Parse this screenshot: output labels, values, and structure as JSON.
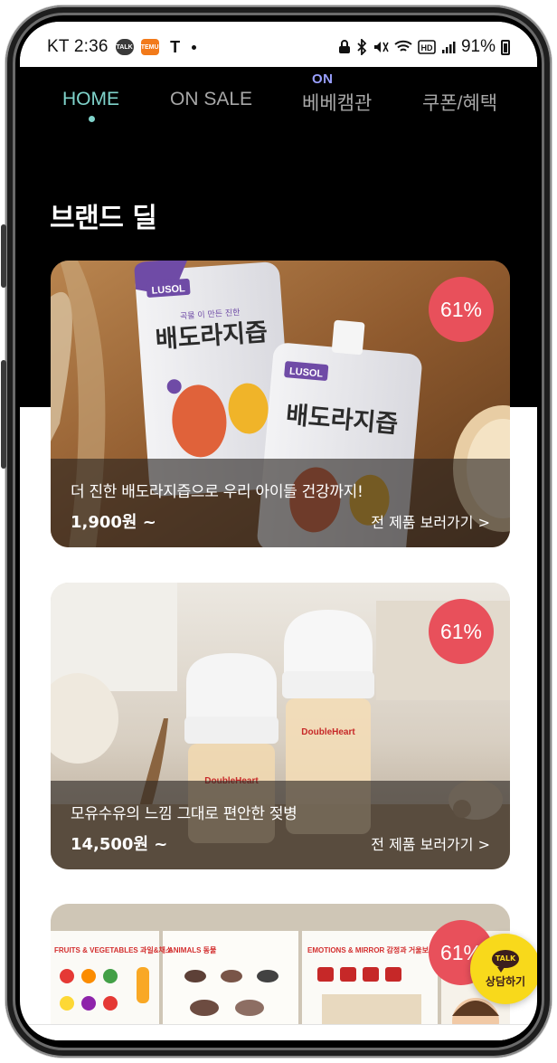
{
  "status_bar": {
    "carrier": "KT",
    "time": "2:36",
    "chip_talk": "TALK",
    "chip_temu": "TEMU",
    "chip_t": "T",
    "battery": "91%"
  },
  "tabs": [
    {
      "label": "HOME",
      "active": true
    },
    {
      "label": "ON SALE",
      "active": false
    },
    {
      "label": "베베캠관",
      "badge": "ON",
      "active": false
    },
    {
      "label": "쿠폰/혜택",
      "active": false
    }
  ],
  "section_title": "브랜드 딜",
  "deals": [
    {
      "discount": "61%",
      "description": "더 진한 배도라지즙으로 우리 아이들 건강까지!",
      "price": "1,900원 ~",
      "link": "전 제품 보러가기 >",
      "product_brand": "LUSOL",
      "product_name": "배도라지즙",
      "product_tagline": "곡물 이 만든 진한"
    },
    {
      "discount": "61%",
      "description": "모유수유의 느낌 그대로 편안한 젖병",
      "price": "14,500원 ~",
      "link": "전 제품 보러가기 >",
      "product_brand": "DoubleHeart"
    },
    {
      "discount": "61%",
      "poster_labels": [
        "FRUITS & VEGETABLES 과일&채소",
        "ANIMALS 동물",
        "EMOTIONS & MIRROR 감정과 거울보기"
      ]
    }
  ],
  "kakao": {
    "icon_text": "TALK",
    "label": "상담하기"
  }
}
